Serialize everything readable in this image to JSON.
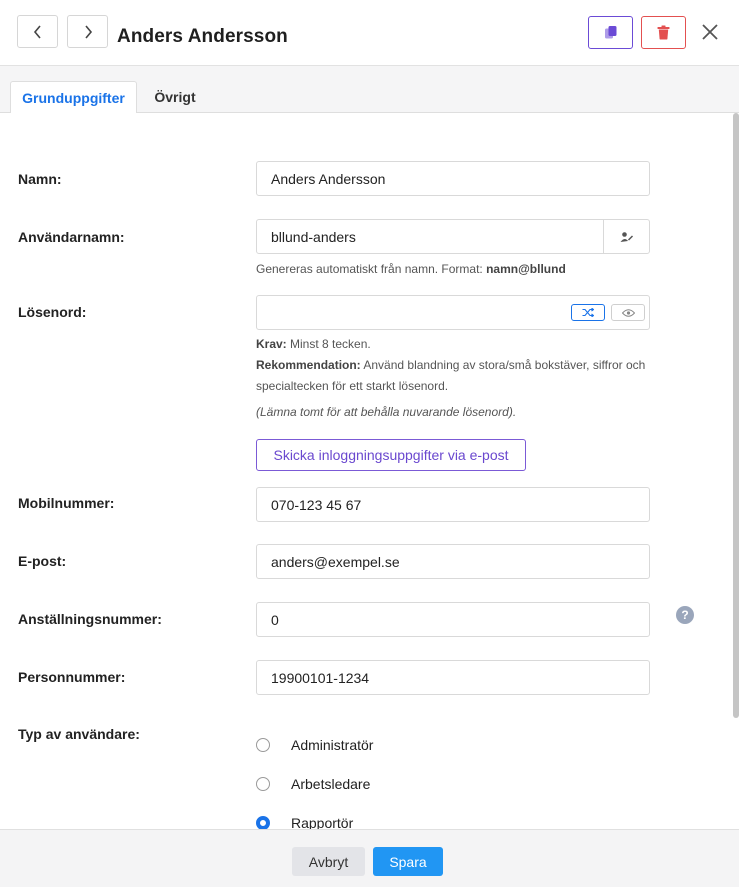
{
  "header": {
    "title": "Anders Andersson",
    "icons": {
      "prev": "chevron-left-icon",
      "next": "chevron-right-icon",
      "copy": "copy-icon",
      "delete": "trash-icon",
      "close": "close-icon"
    }
  },
  "tabs": [
    {
      "label": "Grunduppgifter",
      "active": true
    },
    {
      "label": "Övrigt",
      "active": false
    }
  ],
  "form": {
    "name": {
      "label": "Namn:",
      "value": "Anders Andersson"
    },
    "username": {
      "label": "Användarnamn:",
      "value": "bllund-anders",
      "hint_prefix": "Genereras automatiskt från namn. Format: ",
      "hint_format": "namn@bllund"
    },
    "password": {
      "label": "Lösenord:",
      "value": "",
      "req_label": "Krav:",
      "req_text": " Minst 8 tecken.",
      "rec_label": "Rekommendation:",
      "rec_text_1": " Använd blandning av stora/små bokstäver, siffror och",
      "rec_text_2": "specialtecken för ett starkt lösenord.",
      "keep_note": "(Lämna tomt för att behålla nuvarande lösenord)."
    },
    "send_credentials_label": "Skicka inloggningsuppgifter via e-post",
    "mobile": {
      "label": "Mobilnummer:",
      "value": "070-123 45 67"
    },
    "email": {
      "label": "E-post:",
      "value": "anders@exempel.se"
    },
    "employee_number": {
      "label": "Anställningsnummer:",
      "value": "0",
      "help": "?"
    },
    "personal_number": {
      "label": "Personnummer:",
      "value": "19900101-1234"
    },
    "user_type": {
      "label": "Typ av användare:",
      "options": [
        {
          "label": "Administratör",
          "checked": false
        },
        {
          "label": "Arbetsledare",
          "checked": false
        },
        {
          "label": "Rapportör",
          "checked": true
        }
      ]
    }
  },
  "footer": {
    "cancel_label": "Avbryt",
    "save_label": "Spara"
  },
  "colors": {
    "accent": "#1a73e8",
    "primary_button": "#2196f3",
    "copy_border": "#6b4bd6",
    "delete_border": "#e35050"
  }
}
